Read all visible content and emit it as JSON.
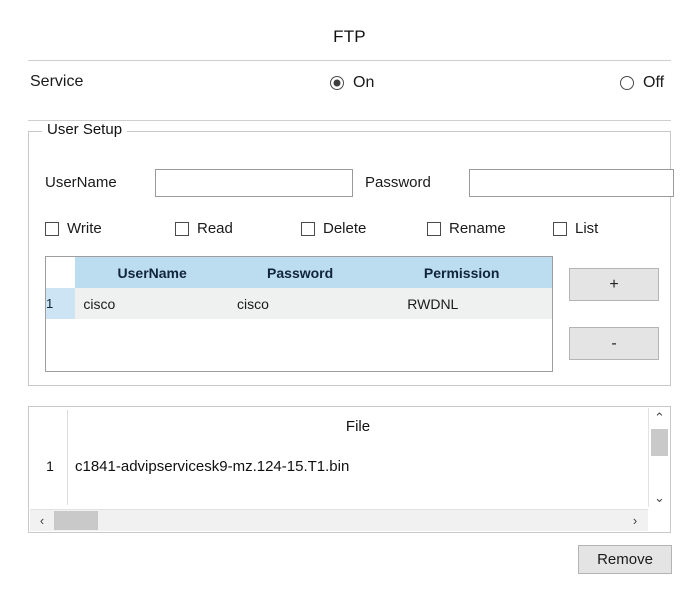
{
  "title": "FTP",
  "service": {
    "label": "Service",
    "options": [
      {
        "label": "On",
        "selected": true
      },
      {
        "label": "Off",
        "selected": false
      }
    ]
  },
  "user_setup": {
    "legend": "User Setup",
    "username_label": "UserName",
    "username_value": "",
    "username_placeholder": "",
    "password_label": "Password",
    "password_value": "",
    "password_placeholder": "",
    "permissions": [
      {
        "label": "Write",
        "checked": false
      },
      {
        "label": "Read",
        "checked": false
      },
      {
        "label": "Delete",
        "checked": false
      },
      {
        "label": "Rename",
        "checked": false
      },
      {
        "label": "List",
        "checked": false
      }
    ],
    "table": {
      "columns": [
        "UserName",
        "Password",
        "Permission"
      ],
      "rows": [
        {
          "index": "1",
          "username": "cisco",
          "password": "cisco",
          "permission": "RWDNL"
        }
      ]
    },
    "add_button": "+",
    "remove_button": "-"
  },
  "file_list": {
    "header": "File",
    "rows": [
      {
        "index": "1",
        "name": "c1841-advipservicesk9-mz.124-15.T1.bin"
      }
    ],
    "scroll_up_icon": "chevron-up-icon",
    "scroll_down_icon": "chevron-down-icon",
    "scroll_left_icon": "chevron-left-icon",
    "scroll_right_icon": "chevron-right-icon",
    "scroll_up_glyph": "⌃",
    "scroll_down_glyph": "⌄",
    "scroll_left_glyph": "‹",
    "scroll_right_glyph": "›"
  },
  "remove_button": "Remove",
  "colors": {
    "table_header_bg": "#bcdcf0",
    "row_index_bg": "#cde4f5",
    "row_data_bg": "#eff0f0",
    "button_bg": "#e4e4e4",
    "border": "#c8c8c8"
  }
}
